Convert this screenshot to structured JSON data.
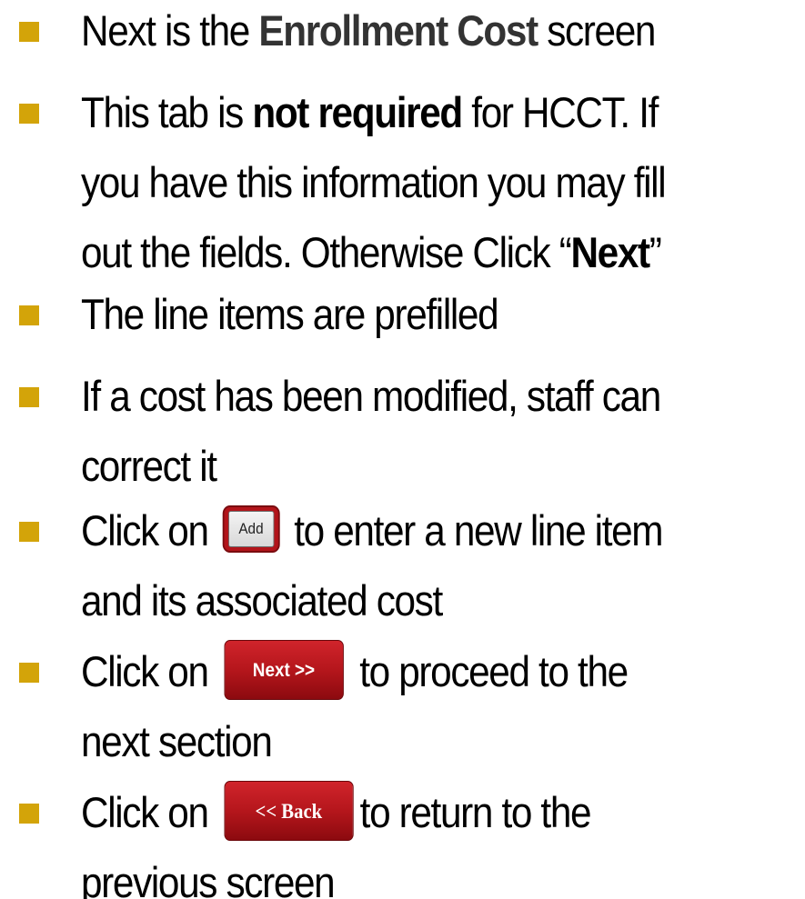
{
  "bullets": [
    {
      "lines": [
        [
          {
            "text": "Next is the "
          },
          {
            "text": "Enrollment Cost",
            "bold": true,
            "gray": true
          },
          {
            "text": " screen"
          }
        ]
      ]
    },
    {
      "lines": [
        [
          {
            "text": "This tab is "
          },
          {
            "text": "not required",
            "bold": true
          },
          {
            "text": " for HCCT. If"
          }
        ],
        [
          {
            "text": "you have this information you may fill"
          }
        ],
        [
          {
            "text": "out the fields. Otherwise Click “"
          },
          {
            "text": "Next",
            "bold": true
          },
          {
            "text": "”"
          }
        ]
      ]
    },
    {
      "lines": [
        [
          {
            "text": "The line items are prefilled"
          }
        ]
      ]
    },
    {
      "lines": [
        [
          {
            "text": "If a cost has been modified, staff can"
          }
        ],
        [
          {
            "text": "correct it"
          }
        ]
      ]
    },
    {
      "lines": [
        [
          {
            "text": "Click on "
          },
          {
            "button": "add"
          },
          {
            "text": " to enter a new line item"
          }
        ],
        [
          {
            "text": "and its associated cost"
          }
        ]
      ]
    },
    {
      "lines": [
        [
          {
            "text": "Click on "
          },
          {
            "button": "next"
          },
          {
            "text": " to proceed to the"
          }
        ],
        [
          {
            "text": "next section"
          }
        ]
      ]
    },
    {
      "lines": [
        [
          {
            "text": "Click on "
          },
          {
            "button": "back"
          },
          {
            "text": "to return to the"
          }
        ],
        [
          {
            "text": "previous screen"
          }
        ]
      ]
    }
  ],
  "buttons": {
    "add": {
      "label": "Add",
      "icon": "add-button-icon"
    },
    "next": {
      "label": "Next >>"
    },
    "back": {
      "label": "<< Back"
    }
  },
  "colors": {
    "bullet": "#D3A409",
    "button_red": "#B5161C",
    "emphasis_gray": "#333333"
  }
}
